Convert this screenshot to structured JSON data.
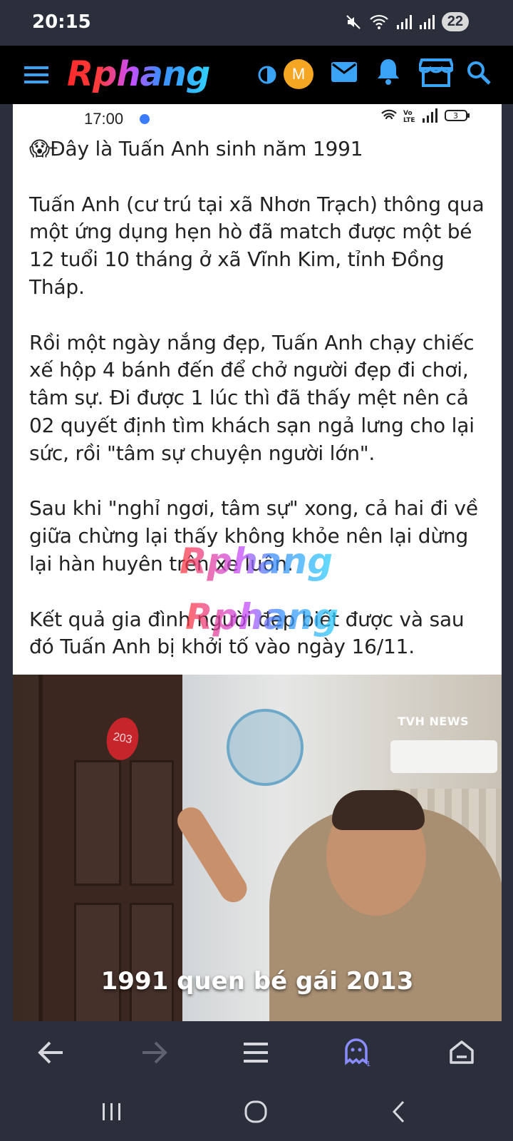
{
  "status_bar": {
    "time": "20:15",
    "battery": "22"
  },
  "app_bar": {
    "logo": "Rphang",
    "avatar_letter": "M"
  },
  "inner_status": {
    "time": "17:00",
    "battery": "3"
  },
  "post": {
    "line1": "😱Đây là Tuấn Anh sinh năm 1991",
    "para1": "Tuấn Anh (cư trú tại xã Nhơn Trạch) thông qua một ứng dụng hẹn hò đã match được một bé 12 tuổi 10 tháng ở xã Vĩnh Kim, tỉnh Đồng Tháp.",
    "para2": "Rồi một ngày nắng đẹp, Tuấn Anh chạy chiếc xế hộp 4 bánh đến để chở người đẹp đi chơi, tâm sự. Đi được 1 lúc thì đã thấy mệt nên cả 02 quyết định tìm khách sạn ngả lưng cho lại sức, rồi \"tâm sự chuyện người lớn\".",
    "para3": "Sau khi \"nghỉ ngơi, tâm sự\" xong, cả hai đi về giữa chừng lại thấy không khỏe nên lại dừng lại hàn huyên trên xe luôn.",
    "para4": "Kết quả gia đình người đẹp biết được và sau đó Tuấn Anh bị khởi tố vào ngày 16/11."
  },
  "watermark": "Rphang",
  "photo": {
    "caption": "1991 quen bé gái 2013",
    "brand": "TVH NEWS",
    "room_number": "203"
  },
  "browser_nav": {
    "tab_count": "1"
  },
  "colors": {
    "bg": "#2b2f3c",
    "appbar": "#000000",
    "accent_blue": "#3aa3f5",
    "avatar": "#f5a623"
  }
}
